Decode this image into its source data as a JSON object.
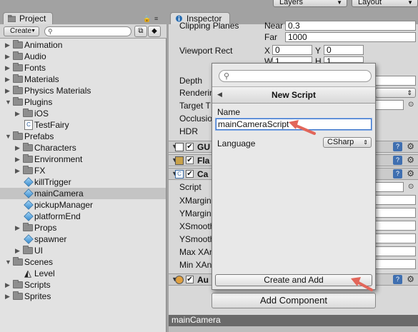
{
  "top_dropdowns": {
    "layers": "Layers",
    "layout": "Layout"
  },
  "project": {
    "tab_title": "Project",
    "create_label": "Create",
    "tree": [
      {
        "label": "Animation",
        "depth": 0,
        "kind": "folder",
        "expanded": false
      },
      {
        "label": "Audio",
        "depth": 0,
        "kind": "folder",
        "expanded": false
      },
      {
        "label": "Fonts",
        "depth": 0,
        "kind": "folder",
        "expanded": false
      },
      {
        "label": "Materials",
        "depth": 0,
        "kind": "folder",
        "expanded": false
      },
      {
        "label": "Physics Materials",
        "depth": 0,
        "kind": "folder",
        "expanded": false
      },
      {
        "label": "Plugins",
        "depth": 0,
        "kind": "folder",
        "expanded": true
      },
      {
        "label": "iOS",
        "depth": 1,
        "kind": "folder",
        "expanded": false
      },
      {
        "label": "TestFairy",
        "depth": 1,
        "kind": "script"
      },
      {
        "label": "Prefabs",
        "depth": 0,
        "kind": "folder",
        "expanded": true
      },
      {
        "label": "Characters",
        "depth": 1,
        "kind": "folder",
        "expanded": false
      },
      {
        "label": "Environment",
        "depth": 1,
        "kind": "folder",
        "expanded": false
      },
      {
        "label": "FX",
        "depth": 1,
        "kind": "folder",
        "expanded": false
      },
      {
        "label": "killTrigger",
        "depth": 1,
        "kind": "prefab"
      },
      {
        "label": "mainCamera",
        "depth": 1,
        "kind": "prefab",
        "selected": true
      },
      {
        "label": "pickupManager",
        "depth": 1,
        "kind": "prefab"
      },
      {
        "label": "platformEnd",
        "depth": 1,
        "kind": "prefab"
      },
      {
        "label": "Props",
        "depth": 1,
        "kind": "folder",
        "expanded": false
      },
      {
        "label": "spawner",
        "depth": 1,
        "kind": "prefab"
      },
      {
        "label": "UI",
        "depth": 1,
        "kind": "folder",
        "expanded": false
      },
      {
        "label": "Scenes",
        "depth": 0,
        "kind": "folder",
        "expanded": true
      },
      {
        "label": "Level",
        "depth": 1,
        "kind": "scene"
      },
      {
        "label": "Scripts",
        "depth": 0,
        "kind": "folder",
        "expanded": false
      },
      {
        "label": "Sprites",
        "depth": 0,
        "kind": "folder",
        "expanded": false
      }
    ]
  },
  "inspector": {
    "tab_title": "Inspector",
    "clipping_planes_label": "Clipping Planes",
    "near_label": "Near",
    "near_value": "0.3",
    "far_label": "Far",
    "far_value": "1000",
    "viewport_rect_label": "Viewport Rect",
    "x_label": "X",
    "x_value": "0",
    "y_label": "Y",
    "y_value": "0",
    "w_label": "W",
    "w_value": "1",
    "h_label": "H",
    "h_value": "1",
    "depth_label": "Depth",
    "rendering_label": "Renderin",
    "target_label": "Target T",
    "occlusion_label": "Occlusio",
    "hdr_label": "HDR",
    "components": [
      "GU",
      "Fla",
      "Ca",
      "Au"
    ],
    "script_label": "Script",
    "script_fields": [
      "XMargin",
      "YMargin",
      "XSmooth",
      "YSmooth",
      "Max XAn",
      "Min XAn"
    ],
    "add_component_label": "Add Component",
    "status_text": "mainCamera"
  },
  "popup": {
    "title": "New Script",
    "name_label": "Name",
    "name_value": "mainCameraScript",
    "language_label": "Language",
    "language_value": "CSharp",
    "create_button_label": "Create and Add"
  },
  "colors": {
    "selection": "#c4c4c4",
    "annotation_arrow": "#e2665a",
    "focus_border": "#3a72c8",
    "status_bar": "#6a6a6a"
  }
}
